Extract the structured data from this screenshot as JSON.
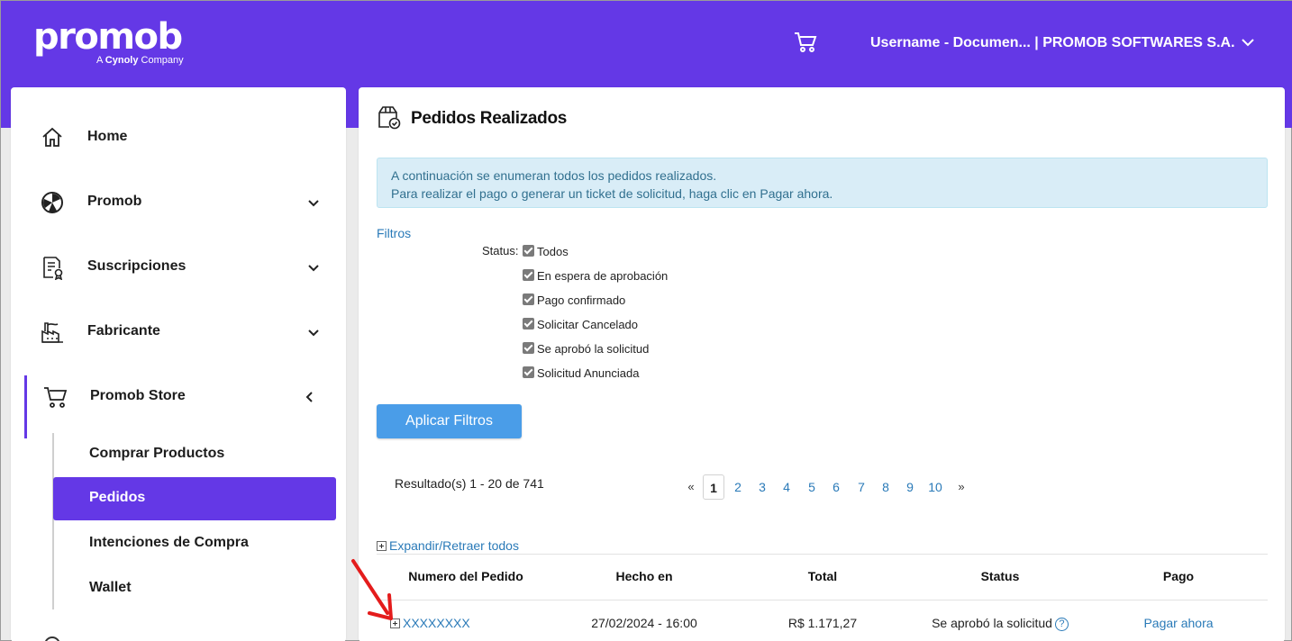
{
  "header": {
    "logo_text": "promob",
    "logo_sub_prefix": "A",
    "logo_sub_brand": "Cynoly",
    "logo_sub_suffix": "Company",
    "user_label": "Username - Documen... | PROMOB SOFTWARES S.A."
  },
  "sidebar": {
    "items": [
      {
        "label": "Home",
        "icon": "home-icon"
      },
      {
        "label": "Promob",
        "icon": "promob-icon"
      },
      {
        "label": "Suscripciones",
        "icon": "subscription-icon"
      },
      {
        "label": "Fabricante",
        "icon": "factory-icon"
      },
      {
        "label": "Promob Store",
        "icon": "cart-icon"
      }
    ],
    "sub_items": [
      "Comprar Productos",
      "Pedidos",
      "Intenciones de Compra",
      "Wallet"
    ],
    "active_sub_item": "Pedidos",
    "accent_color": "#6438e6"
  },
  "page": {
    "title": "Pedidos Realizados",
    "alert_line1": "A continuación se enumeran todos los pedidos realizados.",
    "alert_line2": "Para realizar el pago o generar un ticket de solicitud, haga clic en Pagar ahora."
  },
  "filters": {
    "title": "Filtros",
    "status_label": "Status:",
    "options": [
      {
        "label": "Todos",
        "checked": true
      },
      {
        "label": "En espera de aprobación",
        "checked": true
      },
      {
        "label": "Pago confirmado",
        "checked": true
      },
      {
        "label": "Solicitar Cancelado",
        "checked": true
      },
      {
        "label": "Se aprobó la solicitud",
        "checked": true
      },
      {
        "label": "Solicitud Anunciada",
        "checked": true
      }
    ],
    "apply_label": "Aplicar Filtros"
  },
  "results": {
    "summary": "Resultado(s) 1 - 20 de 741",
    "prev": "«",
    "next": "»",
    "pages": [
      "1",
      "2",
      "3",
      "4",
      "5",
      "6",
      "7",
      "8",
      "9",
      "10"
    ],
    "current_page": "1"
  },
  "table": {
    "expand_label": "Expandir/Retraer todos",
    "headers": [
      "Numero del Pedido",
      "Hecho en",
      "Total",
      "Status",
      "Pago"
    ],
    "rows": [
      {
        "order": "XXXXXXXX",
        "date": "27/02/2024 - 16:00",
        "total": "R$ 1.171,27",
        "status": "Se aprobó la solicitud",
        "status_help": "?",
        "pay": "Pagar ahora"
      }
    ]
  }
}
